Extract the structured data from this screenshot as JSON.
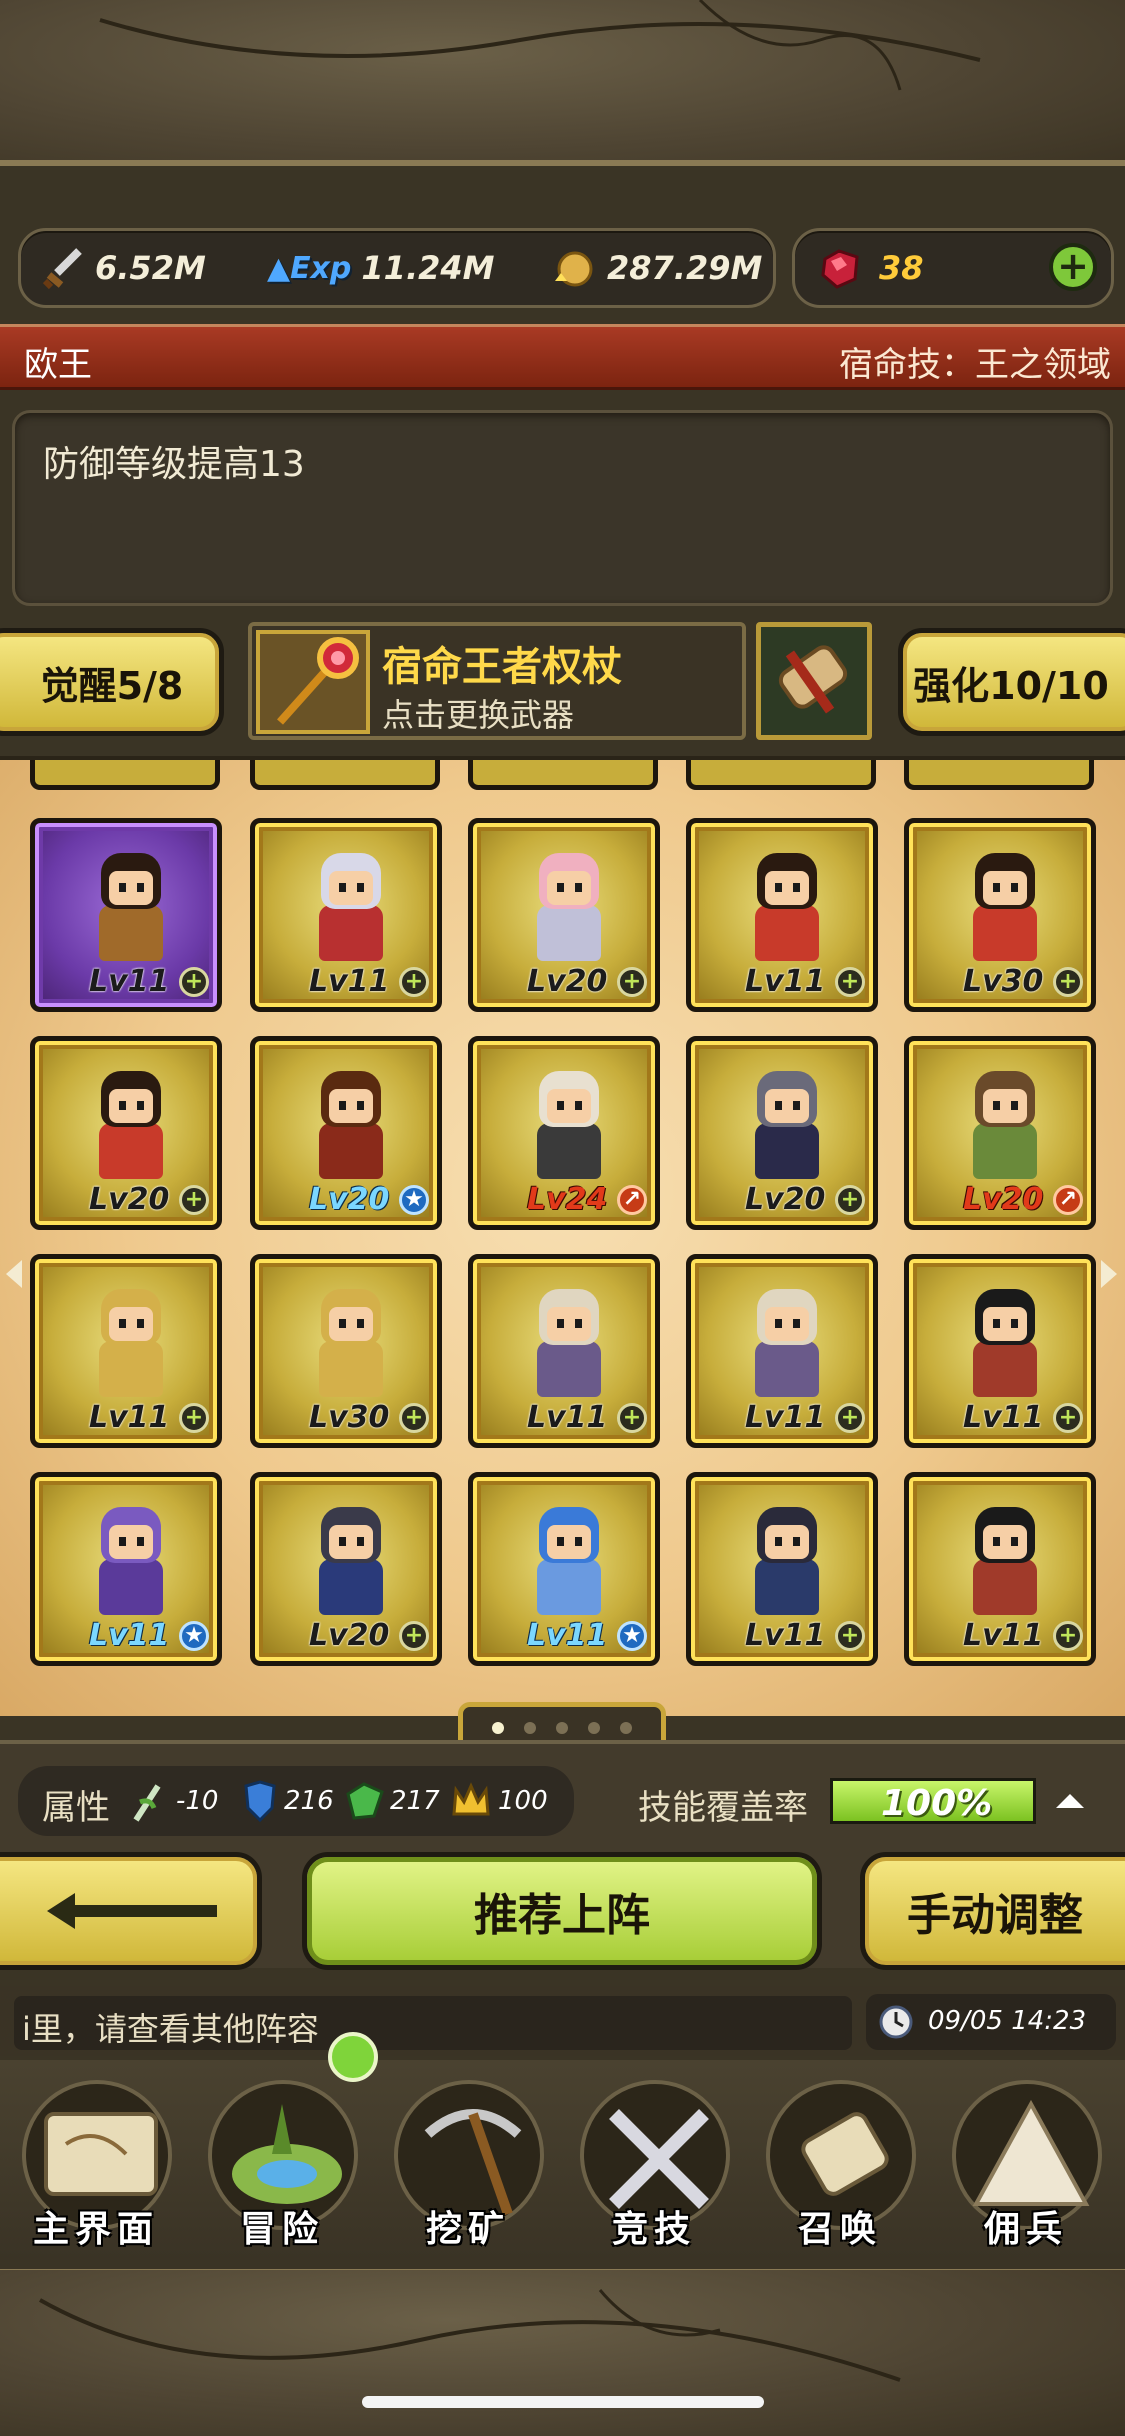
{
  "resources": {
    "attack": "6.52M",
    "exp_label": "Exp",
    "exp": "11.24M",
    "gold": "287.29M",
    "gems": "38"
  },
  "hero": {
    "name": "欧王",
    "destiny_skill": "宿命技：王之领域",
    "description": "防御等级提高13"
  },
  "awaken": {
    "label": "觉醒5/8"
  },
  "weapon": {
    "name": "宿命王者权杖",
    "hint": "点击更换武器"
  },
  "enhance": {
    "label": "强化10/10"
  },
  "cards": [
    {
      "level": "Lv11",
      "badge": "plus"
    },
    {
      "level": "Lv11",
      "badge": "plus"
    },
    {
      "level": "Lv20",
      "badge": "plus"
    },
    {
      "level": "Lv11",
      "badge": "plus"
    },
    {
      "level": "Lv30",
      "badge": "plus"
    },
    {
      "level": "Lv20",
      "badge": "plus"
    },
    {
      "level": "Lv20",
      "badge": "star"
    },
    {
      "level": "Lv24",
      "badge": "arrow"
    },
    {
      "level": "Lv20",
      "badge": "plus"
    },
    {
      "level": "Lv20",
      "badge": "arrow"
    },
    {
      "level": "Lv11",
      "badge": "plus"
    },
    {
      "level": "Lv30",
      "badge": "plus"
    },
    {
      "level": "Lv11",
      "badge": "plus"
    },
    {
      "level": "Lv11",
      "badge": "plus"
    },
    {
      "level": "Lv11",
      "badge": "plus"
    },
    {
      "level": "Lv11",
      "badge": "star"
    },
    {
      "level": "Lv20",
      "badge": "plus"
    },
    {
      "level": "Lv11",
      "badge": "star"
    },
    {
      "level": "Lv11",
      "badge": "plus"
    },
    {
      "level": "Lv11",
      "badge": "plus"
    }
  ],
  "stats": {
    "label": "属性",
    "attr1": "-10",
    "defense": "216",
    "attr3": "217",
    "attr4": "100",
    "coverage_label": "技能覆盖率",
    "coverage_value": "100%"
  },
  "buttons": {
    "recommend": "推荐上阵",
    "manual": "手动调整"
  },
  "ticker": {
    "text": "i里，请查看其他阵容",
    "time": "09/05 14:23"
  },
  "nav": [
    {
      "label": "主界面"
    },
    {
      "label": "冒险"
    },
    {
      "label": "挖矿"
    },
    {
      "label": "竞技"
    },
    {
      "label": "召唤"
    },
    {
      "label": "佣兵"
    }
  ]
}
